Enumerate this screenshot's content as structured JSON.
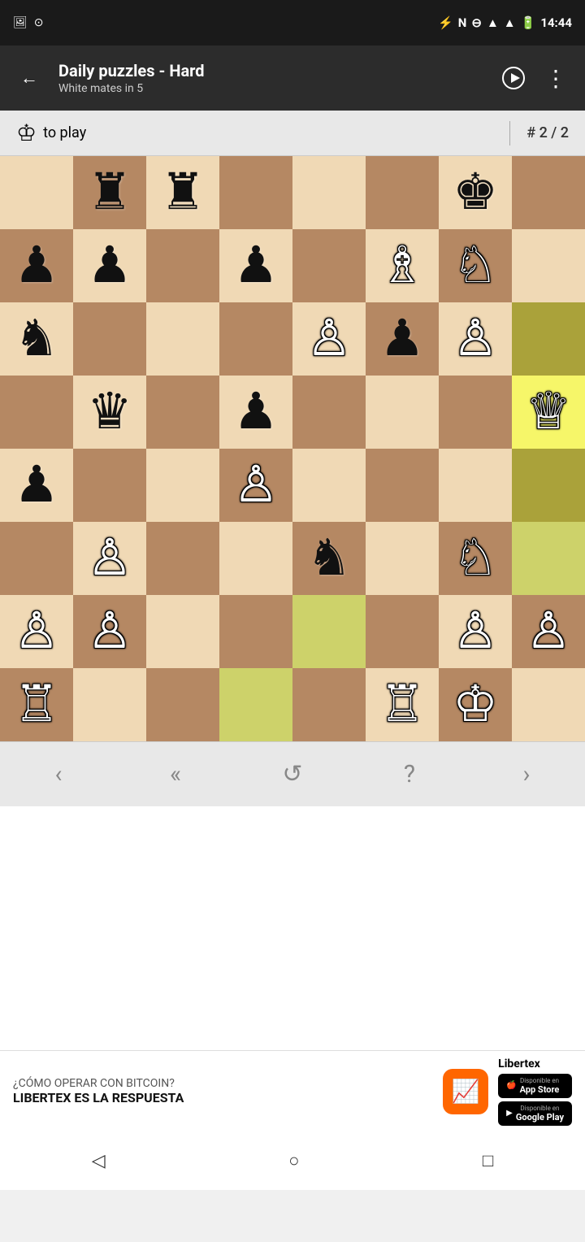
{
  "statusBar": {
    "time": "14:44",
    "icons": [
      "bluetooth",
      "nfc",
      "minus-circle",
      "wifi",
      "signal",
      "battery"
    ]
  },
  "appBar": {
    "backLabel": "←",
    "title": "Daily puzzles - Hard",
    "subtitle": "White mates in 5",
    "playLabel": "▶",
    "moreLabel": "⋮"
  },
  "puzzleInfo": {
    "kingIcon": "♔",
    "toPlay": "to play",
    "puzzleNum": "# 2 / 2"
  },
  "board": {
    "size": 8,
    "cells": [
      {
        "row": 0,
        "col": 0,
        "color": "light",
        "piece": ""
      },
      {
        "row": 0,
        "col": 1,
        "color": "dark",
        "piece": "♜"
      },
      {
        "row": 0,
        "col": 2,
        "color": "light",
        "piece": "♜"
      },
      {
        "row": 0,
        "col": 3,
        "color": "dark",
        "piece": ""
      },
      {
        "row": 0,
        "col": 4,
        "color": "light",
        "piece": ""
      },
      {
        "row": 0,
        "col": 5,
        "color": "dark",
        "piece": ""
      },
      {
        "row": 0,
        "col": 6,
        "color": "light",
        "piece": "♚"
      },
      {
        "row": 0,
        "col": 7,
        "color": "dark",
        "piece": ""
      },
      {
        "row": 1,
        "col": 0,
        "color": "dark",
        "piece": "♟"
      },
      {
        "row": 1,
        "col": 1,
        "color": "light",
        "piece": "♟"
      },
      {
        "row": 1,
        "col": 2,
        "color": "dark",
        "piece": ""
      },
      {
        "row": 1,
        "col": 3,
        "color": "light",
        "piece": "♟"
      },
      {
        "row": 1,
        "col": 4,
        "color": "dark",
        "piece": ""
      },
      {
        "row": 1,
        "col": 5,
        "color": "light",
        "piece": "♗"
      },
      {
        "row": 1,
        "col": 6,
        "color": "dark",
        "piece": "♘"
      },
      {
        "row": 1,
        "col": 7,
        "color": "light",
        "piece": ""
      },
      {
        "row": 2,
        "col": 0,
        "color": "light",
        "piece": "♞"
      },
      {
        "row": 2,
        "col": 1,
        "color": "dark",
        "piece": ""
      },
      {
        "row": 2,
        "col": 2,
        "color": "light",
        "piece": ""
      },
      {
        "row": 2,
        "col": 3,
        "color": "dark",
        "piece": ""
      },
      {
        "row": 2,
        "col": 4,
        "color": "light",
        "piece": "♙"
      },
      {
        "row": 2,
        "col": 5,
        "color": "dark",
        "piece": "♟"
      },
      {
        "row": 2,
        "col": 6,
        "color": "light",
        "piece": "♙"
      },
      {
        "row": 2,
        "col": 7,
        "color": "dark",
        "piece": "highlight"
      },
      {
        "row": 3,
        "col": 0,
        "color": "dark",
        "piece": ""
      },
      {
        "row": 3,
        "col": 1,
        "color": "light",
        "piece": "♛"
      },
      {
        "row": 3,
        "col": 2,
        "color": "dark",
        "piece": ""
      },
      {
        "row": 3,
        "col": 3,
        "color": "light",
        "piece": "♟"
      },
      {
        "row": 3,
        "col": 4,
        "color": "dark",
        "piece": ""
      },
      {
        "row": 3,
        "col": 5,
        "color": "light",
        "piece": ""
      },
      {
        "row": 3,
        "col": 6,
        "color": "dark",
        "piece": ""
      },
      {
        "row": 3,
        "col": 7,
        "color": "light",
        "piece": "♕",
        "special": "yellow"
      },
      {
        "row": 4,
        "col": 0,
        "color": "light",
        "piece": "♟"
      },
      {
        "row": 4,
        "col": 1,
        "color": "dark",
        "piece": ""
      },
      {
        "row": 4,
        "col": 2,
        "color": "light",
        "piece": ""
      },
      {
        "row": 4,
        "col": 3,
        "color": "dark",
        "piece": "♙"
      },
      {
        "row": 4,
        "col": 4,
        "color": "light",
        "piece": ""
      },
      {
        "row": 4,
        "col": 5,
        "color": "dark",
        "piece": ""
      },
      {
        "row": 4,
        "col": 6,
        "color": "light",
        "piece": ""
      },
      {
        "row": 4,
        "col": 7,
        "color": "dark",
        "piece": "highlight"
      },
      {
        "row": 5,
        "col": 0,
        "color": "dark",
        "piece": ""
      },
      {
        "row": 5,
        "col": 1,
        "color": "light",
        "piece": "♙"
      },
      {
        "row": 5,
        "col": 2,
        "color": "dark",
        "piece": ""
      },
      {
        "row": 5,
        "col": 3,
        "color": "light",
        "piece": ""
      },
      {
        "row": 5,
        "col": 4,
        "color": "dark",
        "piece": "♞"
      },
      {
        "row": 5,
        "col": 5,
        "color": "light",
        "piece": ""
      },
      {
        "row": 5,
        "col": 6,
        "color": "dark",
        "piece": "♘"
      },
      {
        "row": 5,
        "col": 7,
        "color": "light",
        "piece": "highlight"
      },
      {
        "row": 6,
        "col": 0,
        "color": "light",
        "piece": "♙"
      },
      {
        "row": 6,
        "col": 1,
        "color": "dark",
        "piece": "♙"
      },
      {
        "row": 6,
        "col": 2,
        "color": "light",
        "piece": ""
      },
      {
        "row": 6,
        "col": 3,
        "color": "dark",
        "piece": ""
      },
      {
        "row": 6,
        "col": 4,
        "color": "light",
        "piece": "highlight"
      },
      {
        "row": 6,
        "col": 5,
        "color": "dark",
        "piece": ""
      },
      {
        "row": 6,
        "col": 6,
        "color": "light",
        "piece": "♙"
      },
      {
        "row": 6,
        "col": 7,
        "color": "dark",
        "piece": "♙"
      },
      {
        "row": 7,
        "col": 0,
        "color": "dark",
        "piece": "♖"
      },
      {
        "row": 7,
        "col": 1,
        "color": "light",
        "piece": ""
      },
      {
        "row": 7,
        "col": 2,
        "color": "dark",
        "piece": ""
      },
      {
        "row": 7,
        "col": 3,
        "color": "light",
        "piece": "highlight"
      },
      {
        "row": 7,
        "col": 4,
        "color": "dark",
        "piece": ""
      },
      {
        "row": 7,
        "col": 5,
        "color": "light",
        "piece": "♖"
      },
      {
        "row": 7,
        "col": 6,
        "color": "dark",
        "piece": "♔"
      },
      {
        "row": 7,
        "col": 7,
        "color": "light",
        "piece": ""
      }
    ]
  },
  "navBar": {
    "prevLabel": "‹",
    "firstLabel": "«",
    "undoLabel": "↺",
    "hintLabel": "?",
    "nextLabel": "›"
  },
  "ad": {
    "line1": "¿CÓMO OPERAR CON BITCOIN?",
    "line2": "LIBERTEX ES LA RESPUESTA",
    "brand": "Libertex",
    "logoIcon": "📈",
    "appStoreLabel": "App Store",
    "playStoreLabel": "Google Play"
  },
  "systemNav": {
    "backLabel": "◁",
    "homeLabel": "○",
    "recentLabel": "□"
  }
}
